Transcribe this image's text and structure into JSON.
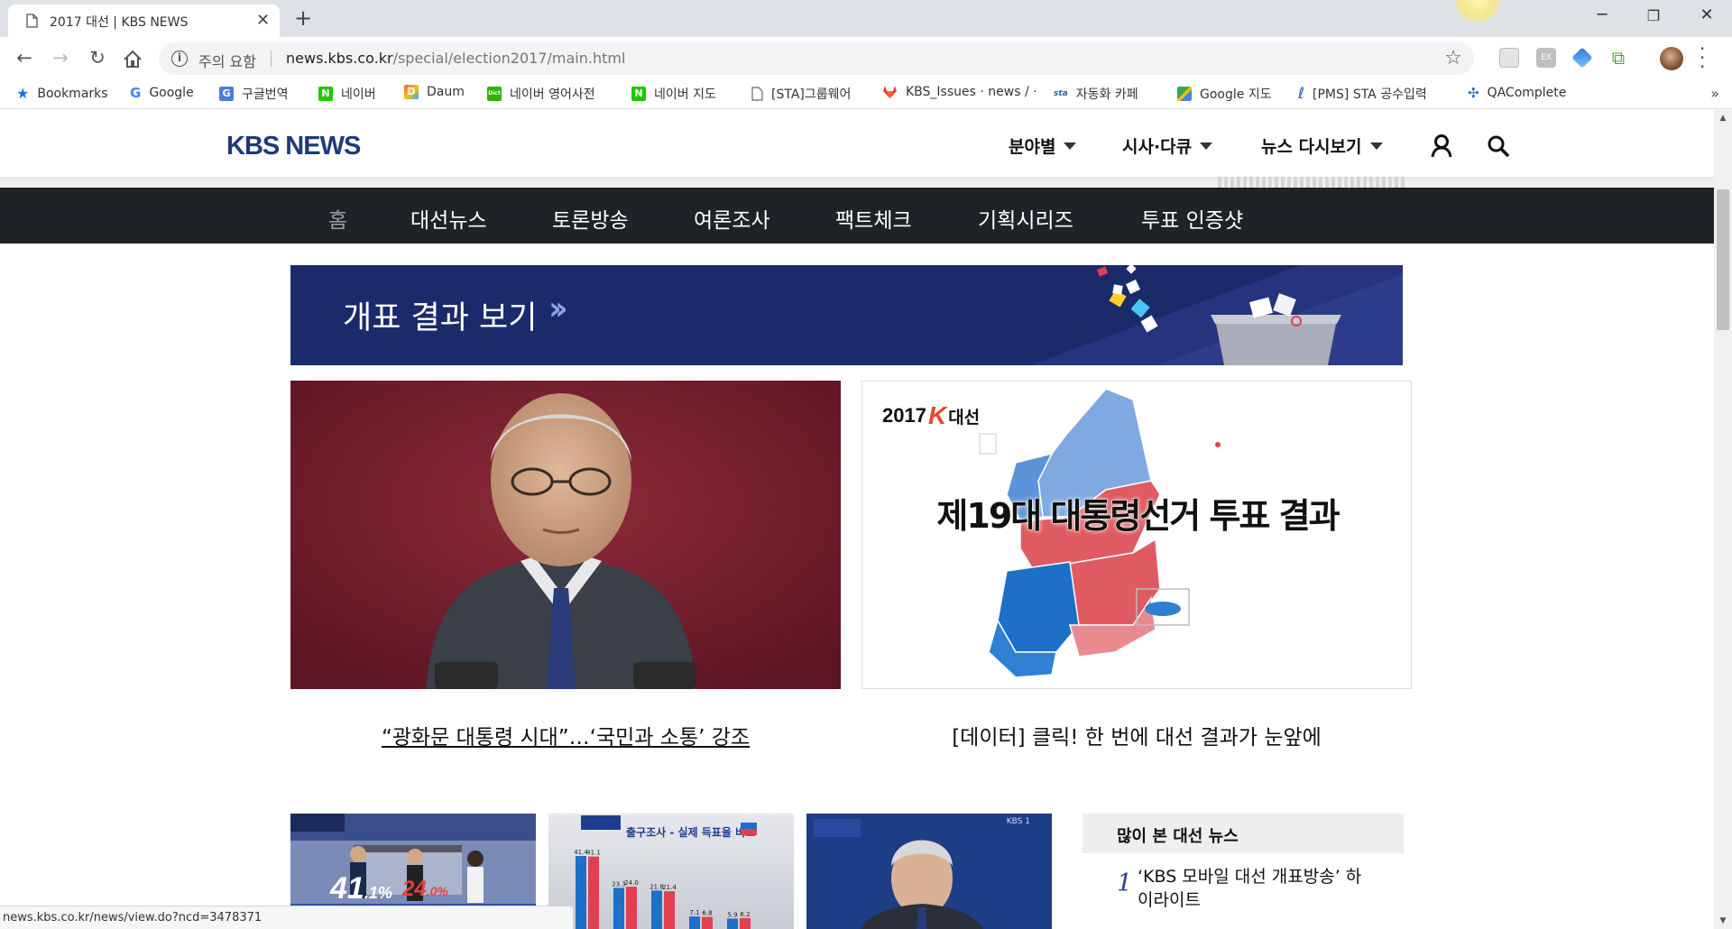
{
  "browser": {
    "tab_title": "2017 대선 | KBS NEWS",
    "security_label": "주의 요함",
    "url_host": "news.kbs.co.kr",
    "url_path": "/special/election2017/main.html",
    "status_url": "news.kbs.co.kr/news/view.do?ncd=3478371"
  },
  "bookmarks": [
    {
      "label": "Bookmarks",
      "icon": "star-icon",
      "color": "#1a73e8"
    },
    {
      "label": "Google",
      "icon": "google-icon",
      "color": "#4285f4"
    },
    {
      "label": "구글번역",
      "icon": "google-translate-icon",
      "color": "#4a7ed9"
    },
    {
      "label": "네이버",
      "icon": "naver-icon",
      "color": "#1ec800"
    },
    {
      "label": "Daum",
      "icon": "daum-icon",
      "color": "#ff5a4a"
    },
    {
      "label": "네이버 영어사전",
      "icon": "naver-dictionary-icon",
      "color": "#2db400"
    },
    {
      "label": "네이버 지도",
      "icon": "naver-map-icon",
      "color": "#1ec800"
    },
    {
      "label": "[STA]그룹웨어",
      "icon": "page-icon",
      "color": "#888888"
    },
    {
      "label": "KBS_Issues · news / ·",
      "icon": "gitlab-icon",
      "color": "#e2432a"
    },
    {
      "label": "자동화 카페",
      "icon": "sta-icon",
      "color": "#2a5db0"
    },
    {
      "label": "Google 지도",
      "icon": "google-maps-icon",
      "color": "#34a853"
    },
    {
      "label": "[PMS] STA 공수입력",
      "icon": "pms-icon",
      "color": "#2a5db0"
    },
    {
      "label": "QAComplete",
      "icon": "qacomplete-icon",
      "color": "#2a6fbf"
    }
  ],
  "site": {
    "logo": "KBS NEWS",
    "header_menu": [
      "분야별",
      "시사·다큐",
      "뉴스 다시보기"
    ],
    "election_nav": [
      "홈",
      "대선뉴스",
      "토론방송",
      "여론조사",
      "팩트체크",
      "기획시리즈",
      "투표 인증샷"
    ],
    "banner_label": "개표 결과 보기",
    "map_card": {
      "brand_year": "2017",
      "brand_letter": "K",
      "brand_word": "대선",
      "headline": "제19대 대통령선거 투표 결과"
    },
    "hero_captions": [
      "“광화문 대통령 시대”…‘국민과 소통’ 강조",
      "[데이터] 클릭! 한 번에 대선 결과가 눈앞에"
    ],
    "thumb1": {
      "pct_a": "41",
      "pct_a_dec": ".1%",
      "pct_b": "24",
      "pct_b_dec": ".0%"
    },
    "thumb2": {
      "title": "출구조사 - 실제 득표율 비교",
      "bar_labels": [
        "41.4",
        "41.1",
        "23.3",
        "24.0",
        "21.8",
        "21.4",
        "7.1",
        "6.8",
        "5.9",
        "6.2"
      ],
      "bar_values": [
        41.4,
        41.1,
        23.3,
        24.0,
        21.8,
        21.4,
        7.1,
        6.8,
        5.9,
        6.2
      ]
    },
    "thumb3": {
      "channel": "KBS 1"
    },
    "popular": {
      "title": "많이 본 대선 뉴스",
      "rank": "1",
      "item": "‘KBS 모바일 대선 개표방송’ 하이라이트"
    }
  },
  "colors": {
    "brand_navy": "#1b2a6b",
    "nav_bg": "#1f2328",
    "party_blue": "#1e6fc8",
    "party_red": "#e04050"
  }
}
